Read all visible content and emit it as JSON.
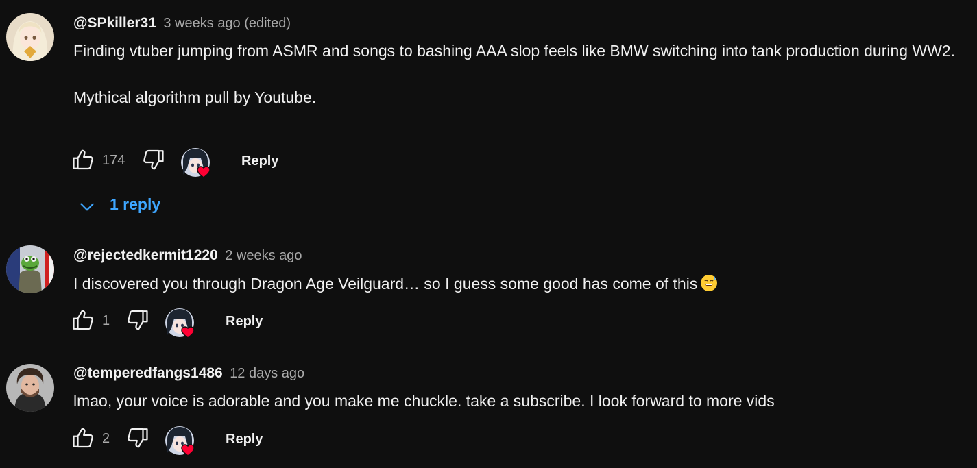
{
  "comments": [
    {
      "author": "@SPkiller31",
      "timestamp": "3 weeks ago (edited)",
      "lines": [
        "Finding vtuber jumping from ASMR and songs to bashing AAA slop feels like BMW switching into tank production during WW2.",
        "Mythical algorithm pull by Youtube."
      ],
      "likes": "174",
      "reply_label": "Reply",
      "replies_label": "1 reply"
    },
    {
      "author": "@rejectedkermit1220",
      "timestamp": "2 weeks ago",
      "lines": [
        "I discovered you through Dragon Age Veilguard… so I guess some good has come of this"
      ],
      "emoji": "grinning-face-with-sweat-icon",
      "likes": "1",
      "reply_label": "Reply"
    },
    {
      "author": "@temperedfangs1486",
      "timestamp": "12 days ago",
      "lines": [
        "lmao, your voice is adorable and you make me chuckle. take a subscribe. I look forward to more vids"
      ],
      "likes": "2",
      "reply_label": "Reply"
    }
  ],
  "colors": {
    "background": "#0f0f0f",
    "text": "#f1f1f1",
    "secondary": "#aaaaaa",
    "link": "#3ea6ff",
    "heart": "#ff0033"
  }
}
